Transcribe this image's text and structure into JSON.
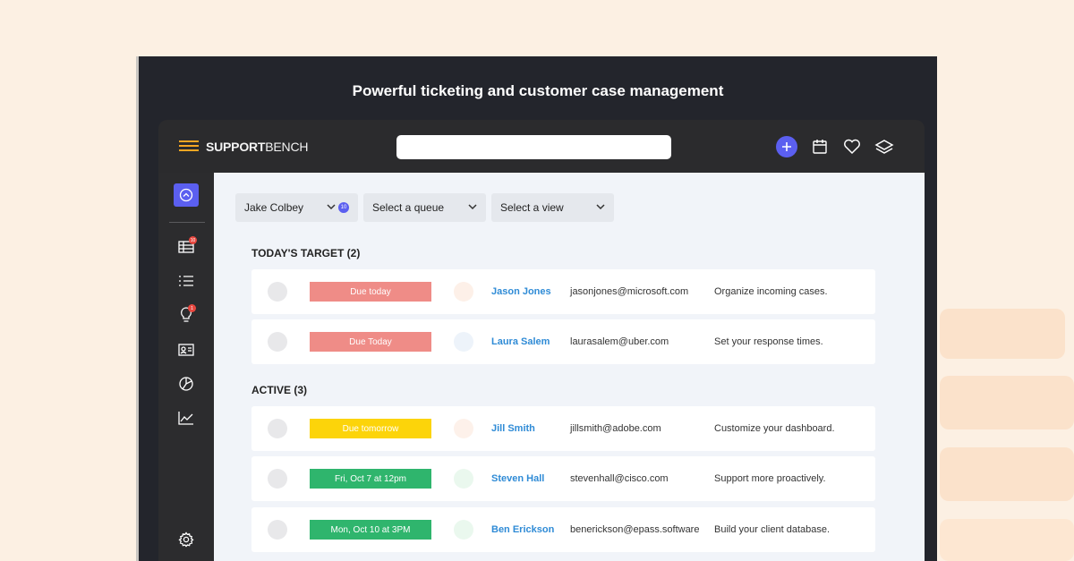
{
  "headline": "Powerful ticketing and customer case management",
  "brand": {
    "strong": "SUPPORT",
    "rest": "BENCH",
    "accent": "#f6a623"
  },
  "search": {
    "value": "",
    "placeholder": ""
  },
  "topbar_icons": [
    "plus-icon",
    "calendar-icon",
    "heart-icon",
    "layers-icon"
  ],
  "sidebar": {
    "items": [
      {
        "icon": "home-icon",
        "active": true
      },
      {
        "icon": "table-icon",
        "badge": "10"
      },
      {
        "icon": "list-icon"
      },
      {
        "icon": "lightbulb-icon",
        "badge": "1"
      },
      {
        "icon": "contact-card-icon"
      },
      {
        "icon": "pie-chart-icon"
      },
      {
        "icon": "line-chart-icon"
      },
      {
        "icon": "gear-icon"
      }
    ]
  },
  "filters": {
    "agent": "Jake Colbey",
    "agent_count": "10",
    "queue": "Select a queue",
    "view": "Select a view"
  },
  "sections": [
    {
      "title": "TODAY'S TARGET (2)",
      "rows": [
        {
          "due": "Due today",
          "due_color": "#ef8c87",
          "avatar_color": "#fdf0e8",
          "name": "Jason Jones",
          "email": "jasonjones@microsoft.com",
          "task": "Organize incoming cases."
        },
        {
          "due": "Due Today",
          "due_color": "#ef8c87",
          "avatar_color": "#edf3fa",
          "name": "Laura Salem",
          "email": "laurasalem@uber.com",
          "task": "Set your response times."
        }
      ]
    },
    {
      "title": "ACTIVE (3)",
      "rows": [
        {
          "due": "Due tomorrow",
          "due_color": "#fcd40a",
          "avatar_color": "#fdf1ea",
          "name": "Jill Smith",
          "email": "jillsmith@adobe.com",
          "task": "Customize your dashboard."
        },
        {
          "due": "Fri, Oct 7 at 12pm",
          "due_color": "#2fb56d",
          "avatar_color": "#eaf8ee",
          "name": "Steven Hall",
          "email": "stevenhall@cisco.com",
          "task": "Support more proactively."
        },
        {
          "due": "Mon, Oct 10 at 3PM",
          "due_color": "#2fb56d",
          "avatar_color": "#eaf8ee",
          "name": "Ben Erickson",
          "email": "benerickson@epass.software",
          "task": "Build your client database."
        }
      ]
    }
  ]
}
